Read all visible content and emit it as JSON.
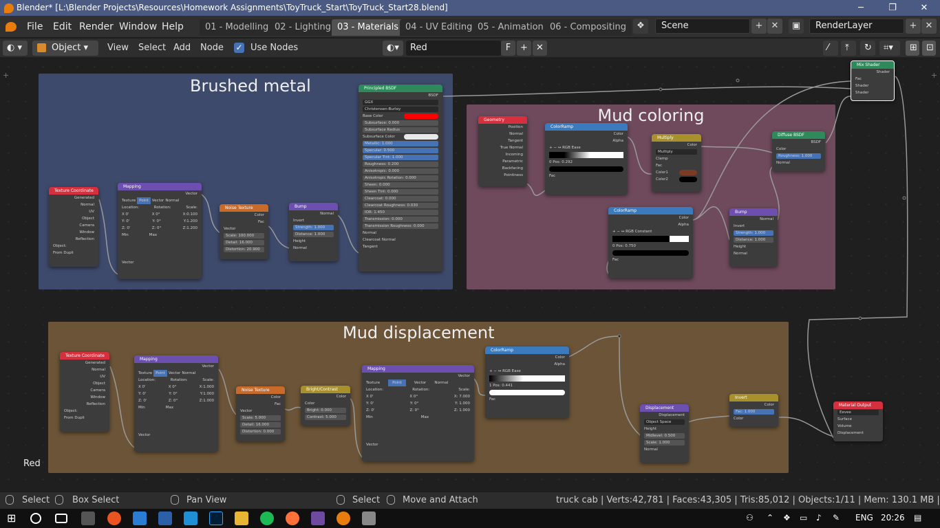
{
  "window": {
    "title": "Blender* [L:\\Blender Projects\\Resources\\Homework Assignments\\ToyTruck_Start\\ToyTruck_Start28.blend]",
    "minimize": "─",
    "restore": "❐",
    "close": "✕"
  },
  "menu": {
    "items": [
      "File",
      "Edit",
      "Render",
      "Window",
      "Help"
    ]
  },
  "workspaces": [
    "01 - Modelling",
    "02 - Lighting",
    "03 - Materials",
    "04 - UV Editing",
    "05 - Animation",
    "06 - Compositing"
  ],
  "active_workspace": "03 - Materials",
  "scene": {
    "label": "Scene",
    "plus": "+",
    "close": "✕"
  },
  "render_layer": {
    "label": "RenderLayer",
    "plus": "+",
    "close": "✕"
  },
  "header": {
    "mode": "Object",
    "view": "View",
    "select": "Select",
    "add": "Add",
    "node": "Node",
    "use_nodes": "Use Nodes",
    "material": "Red",
    "fake_user": "F",
    "new": "+",
    "unlink": "✕"
  },
  "frames": {
    "brushed": "Brushed metal",
    "mud_color": "Mud coloring",
    "mud_disp": "Mud displacement"
  },
  "editor": {
    "material_name_corner": "Red"
  },
  "nodes": {
    "tc1": {
      "title": "Texture Coordinate",
      "rows": [
        "Generated",
        "Normal",
        "UV",
        "Object",
        "Camera",
        "Window",
        "Reflection"
      ],
      "obj": "Object:",
      "dupli": "From Dupli"
    },
    "map1": {
      "title": "Mapping",
      "out": "Vector",
      "tabs": [
        "Texture",
        "Point",
        "Vector",
        "Normal"
      ],
      "hdr": [
        "Location:",
        "Rotation:",
        "Scale:"
      ],
      "r1": [
        "X 0'",
        "X 0°",
        "X:0.100"
      ],
      "r2": [
        "Y: 0'",
        "Y: 0°",
        "Y:1.200"
      ],
      "r3": [
        "Z: 0'",
        "Z: 0°",
        "Z:1.200"
      ],
      "min": "Min",
      "max": "Max",
      "in": "Vector"
    },
    "noise1": {
      "title": "Noise Texture",
      "outs": [
        "Color",
        "Fac"
      ],
      "in": "Vector",
      "fields": [
        "Scale: 100.000",
        "Detail: 16.000",
        "Distortion: 20.900"
      ]
    },
    "bump1": {
      "title": "Bump",
      "out": "Normal",
      "invert": "Invert",
      "fields": [
        "Strength: 1.000",
        "Distance: 1.000"
      ],
      "ins": [
        "Height",
        "Normal"
      ]
    },
    "pbsdf": {
      "title": "Principled BSDF",
      "out": "BSDF",
      "drop1": "GGX",
      "drop2": "Christensen-Burley",
      "base": "Base Color",
      "rows": [
        "Subsurface: 0.000",
        "Subsurface Radius",
        "Subsurface Color",
        "Metallic: 1.000",
        "Specular: 0.500",
        "Specular Tint: 1.000",
        "Roughness: 0.200",
        "Anisotropic: 0.000",
        "Anisotropic Rotation: 0.000",
        "Sheen: 0.000",
        "Sheen Tint: 0.000",
        "Clearcoat: 0.000",
        "Clearcoat Roughness: 0.030",
        "IOR: 1.450",
        "Transmission: 0.000",
        "Transmission Roughness: 0.000"
      ],
      "ins": [
        "Normal",
        "Clearcoat Normal",
        "Tangent"
      ]
    },
    "geom": {
      "title": "Geometry",
      "rows": [
        "Position",
        "Normal",
        "Tangent",
        "True Normal",
        "Incoming",
        "Parametric",
        "Backfacing",
        "Pointiness"
      ]
    },
    "cramp1": {
      "title": "ColorRamp",
      "outs": [
        "Color",
        "Alpha"
      ],
      "ctrl": "+ − ↔  RGB  Ease",
      "pos": "0      Pos: 0.292",
      "in": "Fac"
    },
    "multiply": {
      "title": "Multiply",
      "out": "Color",
      "drop": "Multiply",
      "clamp": "Clamp",
      "ins": [
        "Fac",
        "Color1",
        "Color2"
      ]
    },
    "diffuse": {
      "title": "Diffuse BSDF",
      "out": "BSDF",
      "ins": [
        "Color",
        "Roughness: 1.000",
        "Normal"
      ]
    },
    "cramp2": {
      "title": "ColorRamp",
      "outs": [
        "Color",
        "Alpha"
      ],
      "ctrl": "+ − ↔  RGB  Constant",
      "pos": "0      Pos: 0.750",
      "in": "Fac"
    },
    "bump2": {
      "title": "Bump",
      "out": "Normal",
      "invert": "Invert",
      "fields": [
        "Strength: 1.000",
        "Distance: 1.000"
      ],
      "ins": [
        "Height",
        "Normal"
      ]
    },
    "mixshader": {
      "title": "Mix Shader",
      "out": "Shader",
      "ins": [
        "Fac",
        "Shader",
        "Shader"
      ]
    },
    "tc2": {
      "title": "Texture Coordinate",
      "rows": [
        "Generated",
        "Normal",
        "UV",
        "Object",
        "Camera",
        "Window",
        "Reflection"
      ],
      "obj": "Object:",
      "dupli": "From Dupli"
    },
    "map2": {
      "title": "Mapping",
      "out": "Vector",
      "tabs": [
        "Texture",
        "Point",
        "Vector",
        "Normal"
      ],
      "hdr": [
        "Location:",
        "Rotation:",
        "Scale:"
      ],
      "r1": [
        "X 0'",
        "X 0°",
        "X:1.000"
      ],
      "r2": [
        "Y: 0'",
        "Y: 0°",
        "Y:1.000"
      ],
      "r3": [
        "Z: 0'",
        "Z: 0°",
        "Z:1.000"
      ],
      "min": "Min",
      "max": "Max",
      "in": "Vector"
    },
    "noise2": {
      "title": "Noise Texture",
      "outs": [
        "Color",
        "Fac"
      ],
      "in": "Vector",
      "fields": [
        "Scale: 5.000",
        "Detail: 16.000",
        "Distortion: 0.000"
      ]
    },
    "bc": {
      "title": "Bright/Contrast",
      "out": "Color",
      "ins": [
        "Color",
        "Bright: 0.000",
        "Contrast: 5.000"
      ]
    },
    "map3": {
      "title": "Mapping",
      "out": "Vector",
      "tabs": [
        "Texture",
        "Point",
        "Vector",
        "Normal"
      ],
      "hdr": [
        "Location:",
        "Rotation:",
        "Scale:"
      ],
      "r1": [
        "X 0'",
        "X 0°",
        "X: 7.000"
      ],
      "r2": [
        "Y: 0'",
        "Y: 0°",
        "Y: 1.000"
      ],
      "r3": [
        "Z: 0'",
        "Z: 0°",
        "Z: 1.000"
      ],
      "min": "Min",
      "max": "Max",
      "in": "Vector"
    },
    "cramp3": {
      "title": "ColorRamp",
      "outs": [
        "Color",
        "Alpha"
      ],
      "ctrl": "+ − ↔  RGB  Ease",
      "pos": "1      Pos: 0.441",
      "in": "Fac"
    },
    "disp": {
      "title": "Displacement",
      "out": "Displacement",
      "drop": "Object Space",
      "ins": [
        "Height",
        "Midlevel: 0.500",
        "Scale: 1.000",
        "Normal"
      ]
    },
    "invert": {
      "title": "Invert",
      "out": "Color",
      "ins": [
        "Fac: 1.000",
        "Color"
      ]
    },
    "matout": {
      "title": "Material Output",
      "drop": "Eevee",
      "ins": [
        "Surface",
        "Volume",
        "Displacement"
      ]
    }
  },
  "status": {
    "select1": "Select",
    "box": "Box Select",
    "pan": "Pan View",
    "select2": "Select",
    "move": "Move and Attach",
    "stats": "truck cab | Verts:42,781 | Faces:43,305 | Tris:85,012 | Objects:1/11 | Mem: 130.1 MB | v2.80.25"
  },
  "taskbar": {
    "lang": "ENG",
    "time": "20:26"
  },
  "colors": {
    "frame_blue": "#3e4a6b",
    "frame_pink": "#6e4a5c",
    "frame_brown": "#6b5437",
    "input_red": "#d6303f",
    "vector_purple": "#6c4fae",
    "texture_orange": "#c86a2a",
    "shader_green": "#2e8a5a",
    "converter_blue": "#3b7bbd",
    "color_yellow": "#a8912c",
    "base_red": "#ff0000"
  }
}
